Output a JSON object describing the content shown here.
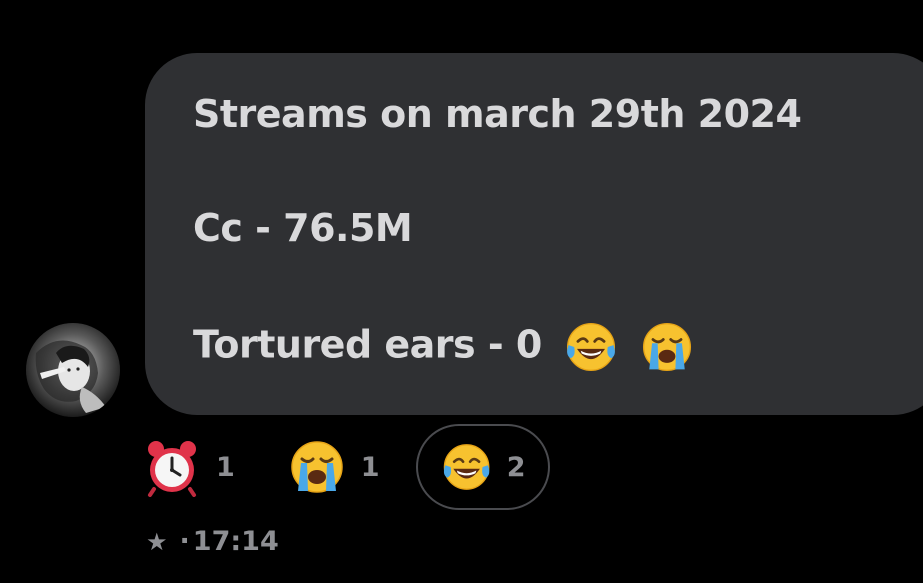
{
  "message": {
    "lines": [
      "Streams on march 29th 2024",
      "Cc - 76.5M",
      "Tortured ears - 0"
    ],
    "trailing_emojis": [
      "face-with-tears-of-joy",
      "loudly-crying-face"
    ]
  },
  "reactions": [
    {
      "emoji": "alarm-clock",
      "count": "1",
      "selected": false
    },
    {
      "emoji": "loudly-crying-face",
      "count": "1",
      "selected": false
    },
    {
      "emoji": "face-with-tears-of-joy",
      "count": "2",
      "selected": true
    }
  ],
  "meta": {
    "star_icon": "★",
    "separator": "·",
    "time": "17:14"
  },
  "colors": {
    "background": "#000000",
    "bubble": "#2f3033",
    "message_text": "#d9d9db",
    "muted_text": "#8e8f93",
    "selected_reaction_border": "#4a4b4f"
  }
}
